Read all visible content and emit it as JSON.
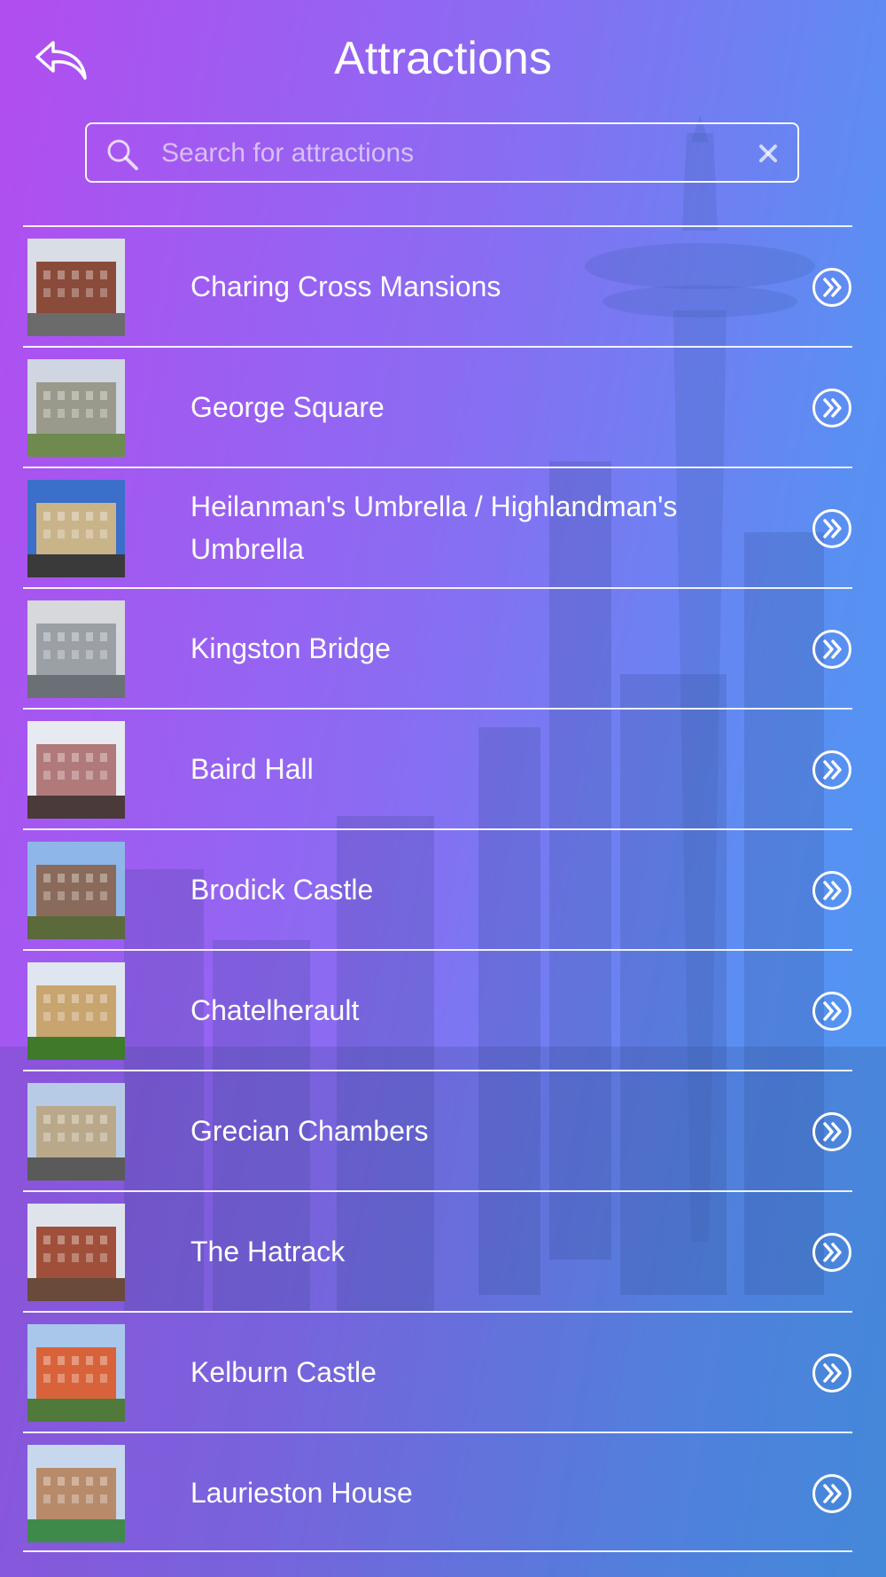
{
  "header": {
    "title": "Attractions",
    "back_icon": "back-arrow-icon"
  },
  "search": {
    "placeholder": "Search for attractions",
    "value": "",
    "icon": "search-icon",
    "clear_icon": "clear-icon"
  },
  "colors": {
    "gradient_left": "#b24df0",
    "gradient_right": "#4a9af0",
    "text": "#ffffff"
  },
  "attractions": [
    {
      "label": "Charing Cross Mansions",
      "thumb_sky": "#d9dde6",
      "thumb_main": "#8a4b3a",
      "thumb_ground": "#6b6b6b"
    },
    {
      "label": "George Square",
      "thumb_sky": "#cfd6e2",
      "thumb_main": "#9a9a8c",
      "thumb_ground": "#6e8a4e"
    },
    {
      "label": "Heilanman's Umbrella / Highlandman's Umbrella",
      "thumb_sky": "#3b6fc9",
      "thumb_main": "#c9b48a",
      "thumb_ground": "#3a3a3a"
    },
    {
      "label": "Kingston Bridge",
      "thumb_sky": "#d6d8dc",
      "thumb_main": "#9aa0a6",
      "thumb_ground": "#6a7076"
    },
    {
      "label": "Baird Hall",
      "thumb_sky": "#e7eaf0",
      "thumb_main": "#b07a7a",
      "thumb_ground": "#4a3a3a"
    },
    {
      "label": "Brodick Castle",
      "thumb_sky": "#8fb6e8",
      "thumb_main": "#8a6a5a",
      "thumb_ground": "#5a6a3a"
    },
    {
      "label": "Chatelherault",
      "thumb_sky": "#dfe6ef",
      "thumb_main": "#c8a46e",
      "thumb_ground": "#3f7a2a"
    },
    {
      "label": "Grecian Chambers",
      "thumb_sky": "#b8cbe6",
      "thumb_main": "#b9a98a",
      "thumb_ground": "#5a5a5a"
    },
    {
      "label": "The Hatrack",
      "thumb_sky": "#dfe4ec",
      "thumb_main": "#a0503a",
      "thumb_ground": "#6a4a3a"
    },
    {
      "label": "Kelburn Castle",
      "thumb_sky": "#a9c7ea",
      "thumb_main": "#d8633a",
      "thumb_ground": "#4f7a3a"
    },
    {
      "label": "Laurieston House",
      "thumb_sky": "#c7d8ee",
      "thumb_main": "#b78a6a",
      "thumb_ground": "#3f8a4a"
    }
  ],
  "row_action_icon": "double-chevron-right-icon"
}
